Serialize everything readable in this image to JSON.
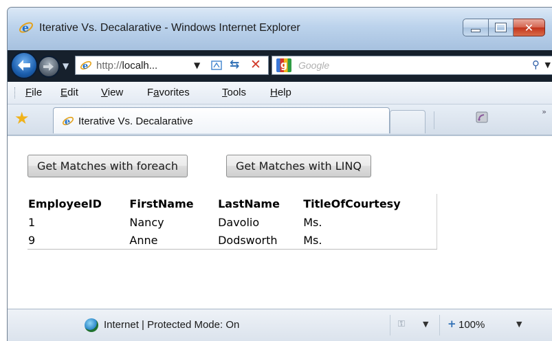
{
  "window": {
    "title": "Iterative Vs. Decalarative - Windows Internet Explorer"
  },
  "navbar": {
    "address": {
      "prefix": "http://",
      "host": "localh...",
      "ellipsis_note": ""
    },
    "search": {
      "placeholder": "Google"
    }
  },
  "menubar": {
    "items": [
      "File",
      "Edit",
      "View",
      "Favorites",
      "Tools",
      "Help"
    ],
    "accelerators": [
      "F",
      "E",
      "V",
      "a",
      "T",
      "H"
    ]
  },
  "tabs": {
    "active_label": "Iterative Vs. Decalarative"
  },
  "content": {
    "buttons": {
      "foreach_label": "Get Matches with foreach",
      "linq_label": "Get Matches with LINQ"
    },
    "table": {
      "columns": [
        "EmployeeID",
        "FirstName",
        "LastName",
        "TitleOfCourtesy"
      ],
      "rows": [
        [
          "1",
          "Nancy",
          "Davolio",
          "Ms."
        ],
        [
          "9",
          "Anne",
          "Dodsworth",
          "Ms."
        ]
      ]
    }
  },
  "statusbar": {
    "zone_text": "Internet | Protected Mode: On",
    "zoom": "100%"
  },
  "colors": {
    "titlebar": "#bcd3ec",
    "navbar": "#16202c",
    "close_button": "#c2341c"
  },
  "icons": {
    "title": "ie-icon",
    "back": "back-arrow-icon",
    "forward": "forward-arrow-icon",
    "refresh": "refresh-icon",
    "stop": "stop-icon",
    "search": "magnifier-icon",
    "favorites": "favorites-star-icon",
    "feed": "feed-icon",
    "status": "internet-globe-icon"
  }
}
